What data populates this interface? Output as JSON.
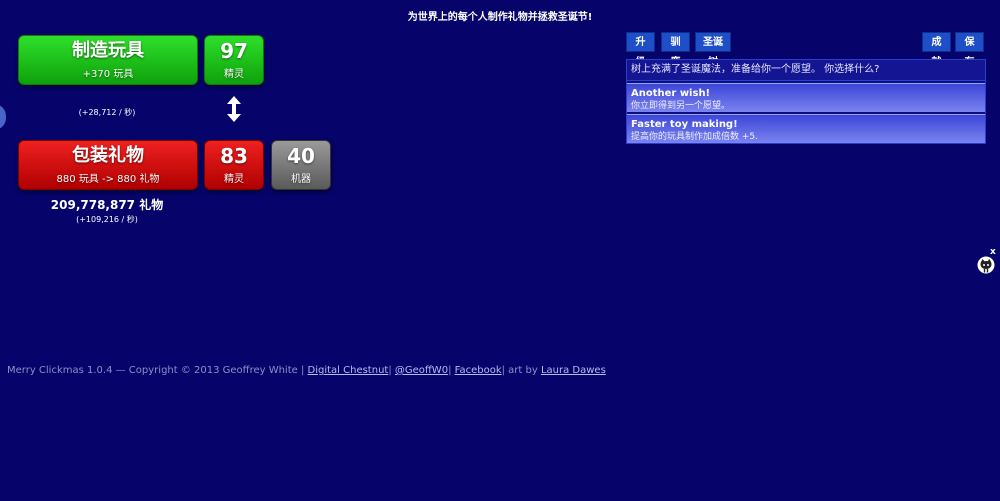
{
  "header": {
    "title": "为世界上的每个人制作礼物并拯救圣诞节!"
  },
  "make_toys": {
    "label": "制造玩具",
    "sub": "+370 玩具",
    "elves_count": "97",
    "elves_label": "精灵",
    "rate": "(+28,712 / 秒)"
  },
  "wrap_gifts": {
    "label": "包装礼物",
    "sub": "880 玩具 -> 880 礼物",
    "elves_count": "83",
    "elves_label": "精灵",
    "machines_count": "40",
    "machines_label": "机器",
    "total": "209,778,877 礼物",
    "rate": "(+109,216 / 秒)"
  },
  "tabs": {
    "upgrades": "升级",
    "reindeer": "驯鹿",
    "tree": "圣诞树",
    "achievements": "成就",
    "save": "保存"
  },
  "tree_panel": {
    "prompt": "树上充满了圣诞魔法，准备给你一个愿望。 你选择什么?",
    "options": [
      {
        "title": "Another wish!",
        "desc": "你立即得到另一个愿望。"
      },
      {
        "title": "Faster toy making!",
        "desc": "提高你的玩具制作加成倍数 +5."
      }
    ]
  },
  "footer": {
    "prefix": "Merry Clickmas 1.0.4 — Copyright © 2013 Geoffrey White | ",
    "link1": "Digital Chestnut",
    "sep1": "| ",
    "link2": "@GeoffW0",
    "sep2": "| ",
    "link3": "Facebook",
    "sep3": "| art by ",
    "link4": "Laura Dawes"
  },
  "close_label": "x",
  "colors": {
    "background": "#06046b",
    "green": "#1ec61a",
    "red": "#d40c0c",
    "tab_blue": "#1f4fc8"
  }
}
